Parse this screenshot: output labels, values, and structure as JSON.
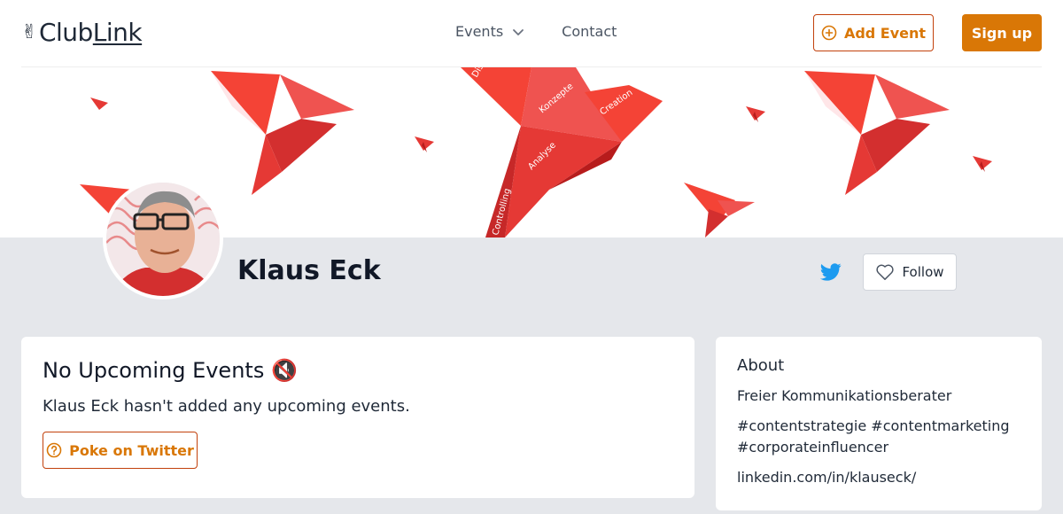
{
  "brand": {
    "hand_icon": "✌",
    "part1": "Club",
    "part2": "Link"
  },
  "nav": {
    "events_label": "Events",
    "contact_label": "Contact"
  },
  "header": {
    "add_event_label": "Add Event",
    "sign_up_label": "Sign up"
  },
  "colors": {
    "accent": "#d97706",
    "accent_border": "#c2410c",
    "twitter": "#1d9bf0",
    "page_bg": "#e5e7eb",
    "banner_red": "#e8281e"
  },
  "banner": {
    "words": [
      "Dist",
      "Konzepte",
      "Creation",
      "Analyse",
      "Controlling"
    ]
  },
  "profile": {
    "name": "Klaus Eck",
    "follow_label": "Follow",
    "twitter_icon": "twitter-icon"
  },
  "events": {
    "title": "No Upcoming Events",
    "title_icon": "🔇",
    "message": "Klaus Eck hasn't added any upcoming events.",
    "poke_label": "Poke on Twitter"
  },
  "about": {
    "title": "About",
    "bio": "Freier Kommunikationsberater",
    "tags": "#contentstrategie #contentmarketing #corporateinfluencer",
    "link": "linkedin.com/in/klauseck/"
  }
}
